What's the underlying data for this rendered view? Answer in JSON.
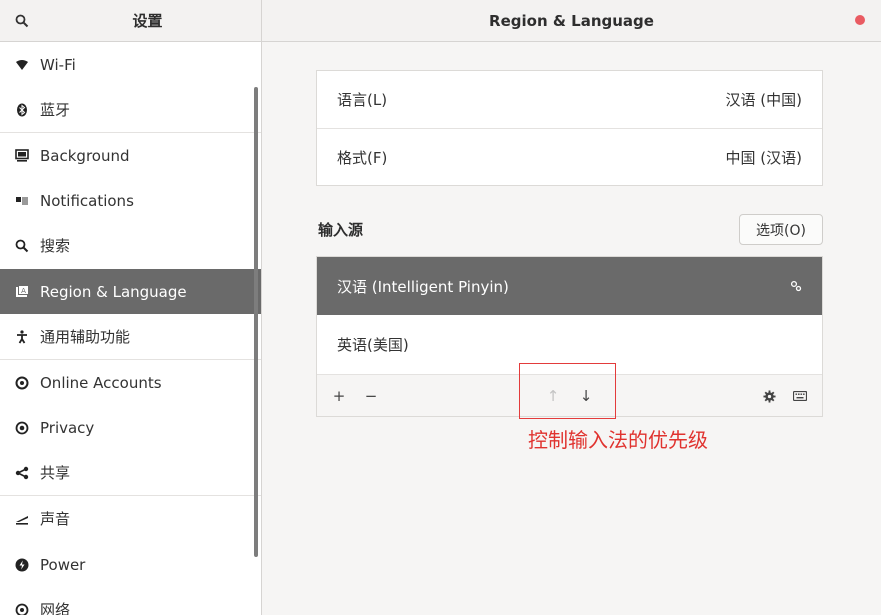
{
  "header": {
    "app_title": "设置",
    "panel_title": "Region & Language"
  },
  "sidebar": {
    "items": [
      {
        "label": "Wi-Fi",
        "icon": "wifi-icon"
      },
      {
        "label": "蓝牙",
        "icon": "bluetooth-icon"
      },
      {
        "label": "Background",
        "icon": "display-icon"
      },
      {
        "label": "Notifications",
        "icon": "notifications-icon"
      },
      {
        "label": "搜索",
        "icon": "search-icon"
      },
      {
        "label": "Region & Language",
        "icon": "region-icon",
        "active": true
      },
      {
        "label": "通用辅助功能",
        "icon": "accessibility-icon"
      },
      {
        "label": "Online Accounts",
        "icon": "online-accounts-icon"
      },
      {
        "label": "Privacy",
        "icon": "privacy-icon"
      },
      {
        "label": "共享",
        "icon": "share-icon"
      },
      {
        "label": "声音",
        "icon": "sound-icon"
      },
      {
        "label": "Power",
        "icon": "power-icon"
      },
      {
        "label": "网络",
        "icon": "network-icon"
      }
    ]
  },
  "language": {
    "rows": [
      {
        "label": "语言(L)",
        "value": "汉语 (中国)"
      },
      {
        "label": "格式(F)",
        "value": "中国 (汉语)"
      }
    ]
  },
  "input_sources": {
    "title": "输入源",
    "options_label": "选项(O)",
    "items": [
      {
        "label": "汉语 (Intelligent Pinyin)",
        "selected": true
      },
      {
        "label": "英语(美国)",
        "selected": false
      }
    ],
    "toolbar": {
      "add": "+",
      "remove": "−",
      "up": "↑",
      "down": "↓"
    }
  },
  "annotation": {
    "text": "控制输入法的优先级"
  },
  "colors": {
    "accent_selected": "#6a6a6a",
    "close_button": "#e95b62",
    "annotation_red": "#e0332f"
  }
}
